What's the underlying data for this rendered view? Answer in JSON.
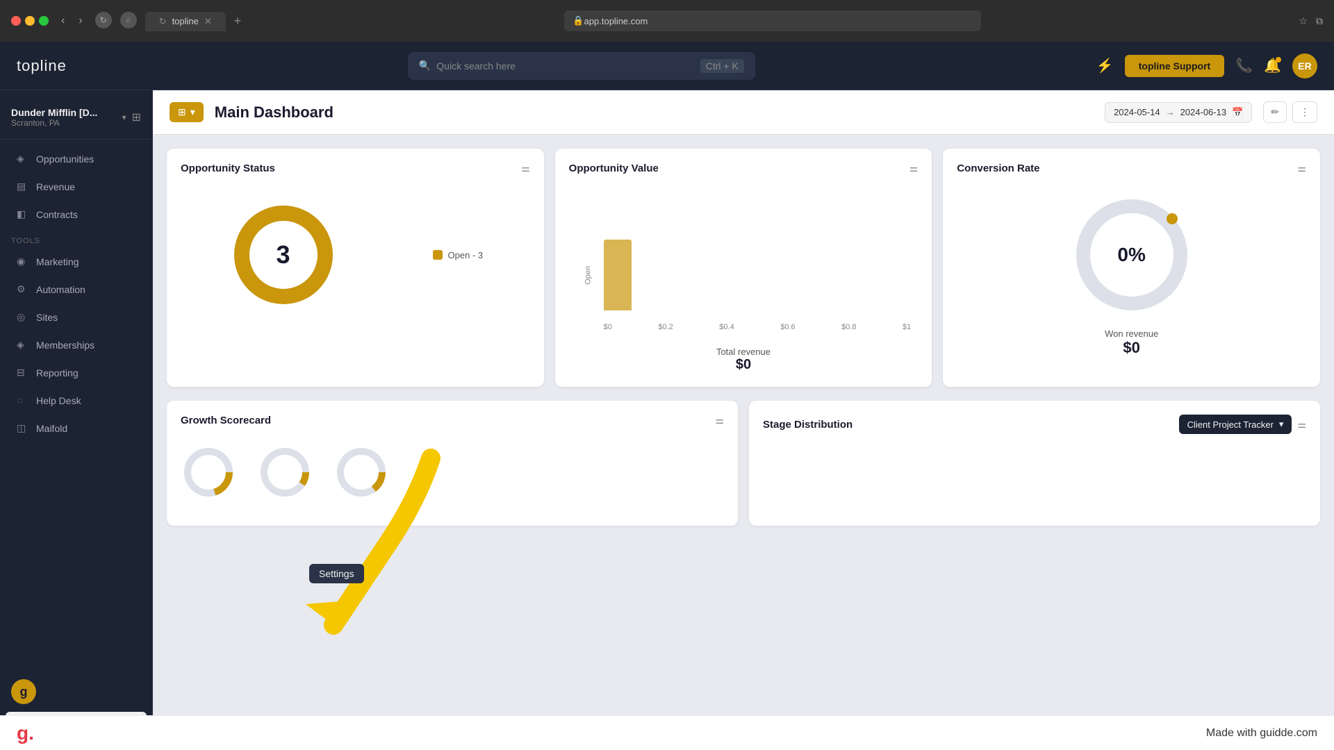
{
  "browser": {
    "tab_title": "topline",
    "new_tab": "+",
    "address": ""
  },
  "topnav": {
    "logo": "topline",
    "search_placeholder": "Quick search here",
    "search_shortcut": "Ctrl + K",
    "support_label": "topline Support",
    "avatar_initials": "ER"
  },
  "sidebar": {
    "company_name": "Dunder Mifflin [D...",
    "company_location": "Scranton, PA",
    "nav_items": [
      {
        "label": "Opportunities",
        "icon": "grid"
      },
      {
        "label": "Revenue",
        "icon": "chart"
      },
      {
        "label": "Contracts",
        "icon": "doc"
      }
    ],
    "tools_label": "Tools",
    "tools_items": [
      {
        "label": "Marketing",
        "icon": "megaphone"
      },
      {
        "label": "Automation",
        "icon": "gear"
      },
      {
        "label": "Sites",
        "icon": "globe"
      },
      {
        "label": "Memberships",
        "icon": "members"
      },
      {
        "label": "Reporting",
        "icon": "report"
      },
      {
        "label": "Help Desk",
        "icon": "help"
      },
      {
        "label": "Maifold",
        "icon": "fold"
      }
    ],
    "settings_label": "Settings"
  },
  "dashboard": {
    "title": "Main Dashboard",
    "date_from": "2024-05-14",
    "date_to": "2024-06-13",
    "widgets": {
      "opportunity_status": {
        "title": "Opportunity Status",
        "donut_value": "3",
        "legend_label": "Open - 3",
        "legend_color": "#c9960c"
      },
      "opportunity_value": {
        "title": "Opportunity Value",
        "open_label": "Open",
        "x_labels": [
          "$0",
          "$0.2",
          "$0.4",
          "$0.6",
          "$0.8",
          "$1"
        ],
        "total_revenue_label": "Total revenue",
        "total_revenue_value": "$0"
      },
      "conversion_rate": {
        "title": "Conversion Rate",
        "percentage": "0%",
        "won_revenue_label": "Won revenue",
        "won_revenue_value": "$0"
      }
    },
    "second_row": {
      "growth_scorecard": {
        "title": "Growth Scorecard"
      },
      "stage_distribution": {
        "title": "Stage Distribution",
        "dropdown_label": "Client Project Tracker"
      }
    }
  },
  "guidde": {
    "logo": "g.",
    "made_with": "Made with guidde.com"
  },
  "settings_tooltip": "Settings"
}
